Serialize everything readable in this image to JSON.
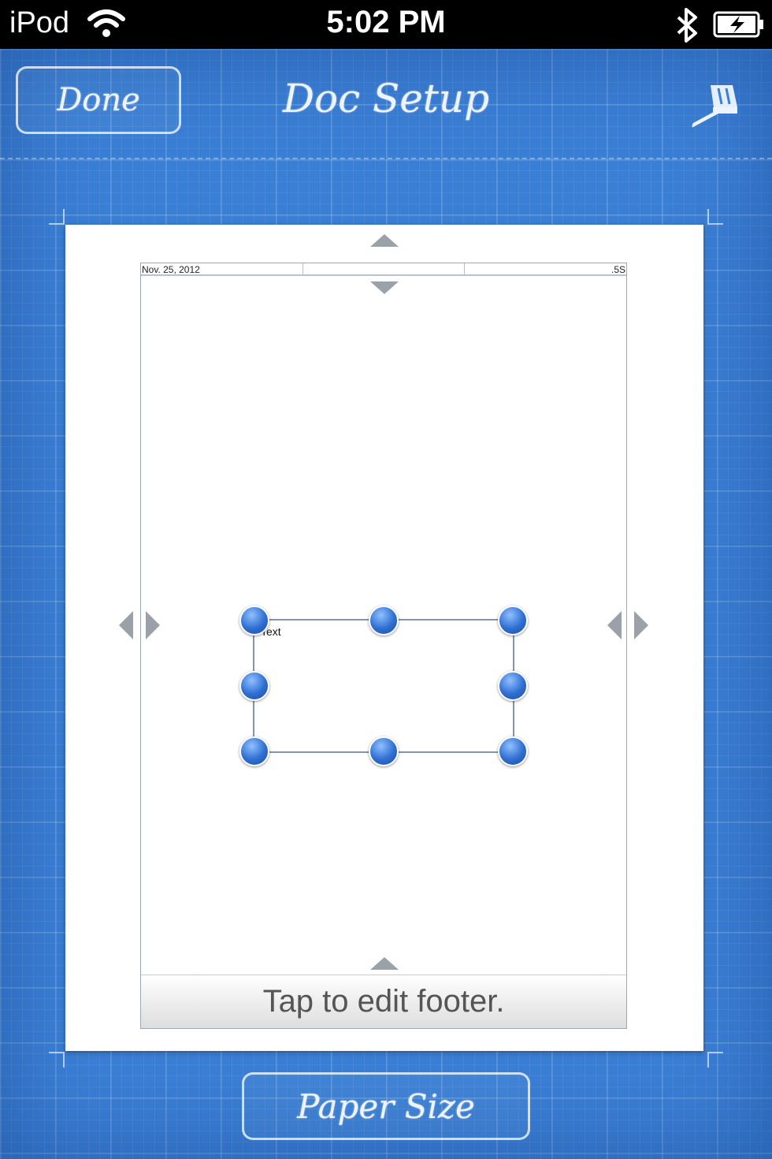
{
  "status_bar": {
    "carrier": "iPod",
    "time": "5:02 PM",
    "wifi_icon": "wifi-icon",
    "bluetooth_icon": "bluetooth-icon",
    "battery_icon": "battery-charging-icon"
  },
  "nav": {
    "done_label": "Done",
    "title": "Doc Setup",
    "style_icon": "paint-brush-icon"
  },
  "page": {
    "header_cells": [
      "Nov. 25, 2012",
      "",
      "",
      ".5S"
    ],
    "selection_text": "Text",
    "footer_label": "Tap to edit footer."
  },
  "bottom": {
    "paper_size_label": "Paper Size"
  },
  "colors": {
    "blueprint": "#3a7fd6",
    "handle": "#2f6ed1",
    "arrow": "#9aa1a8"
  }
}
